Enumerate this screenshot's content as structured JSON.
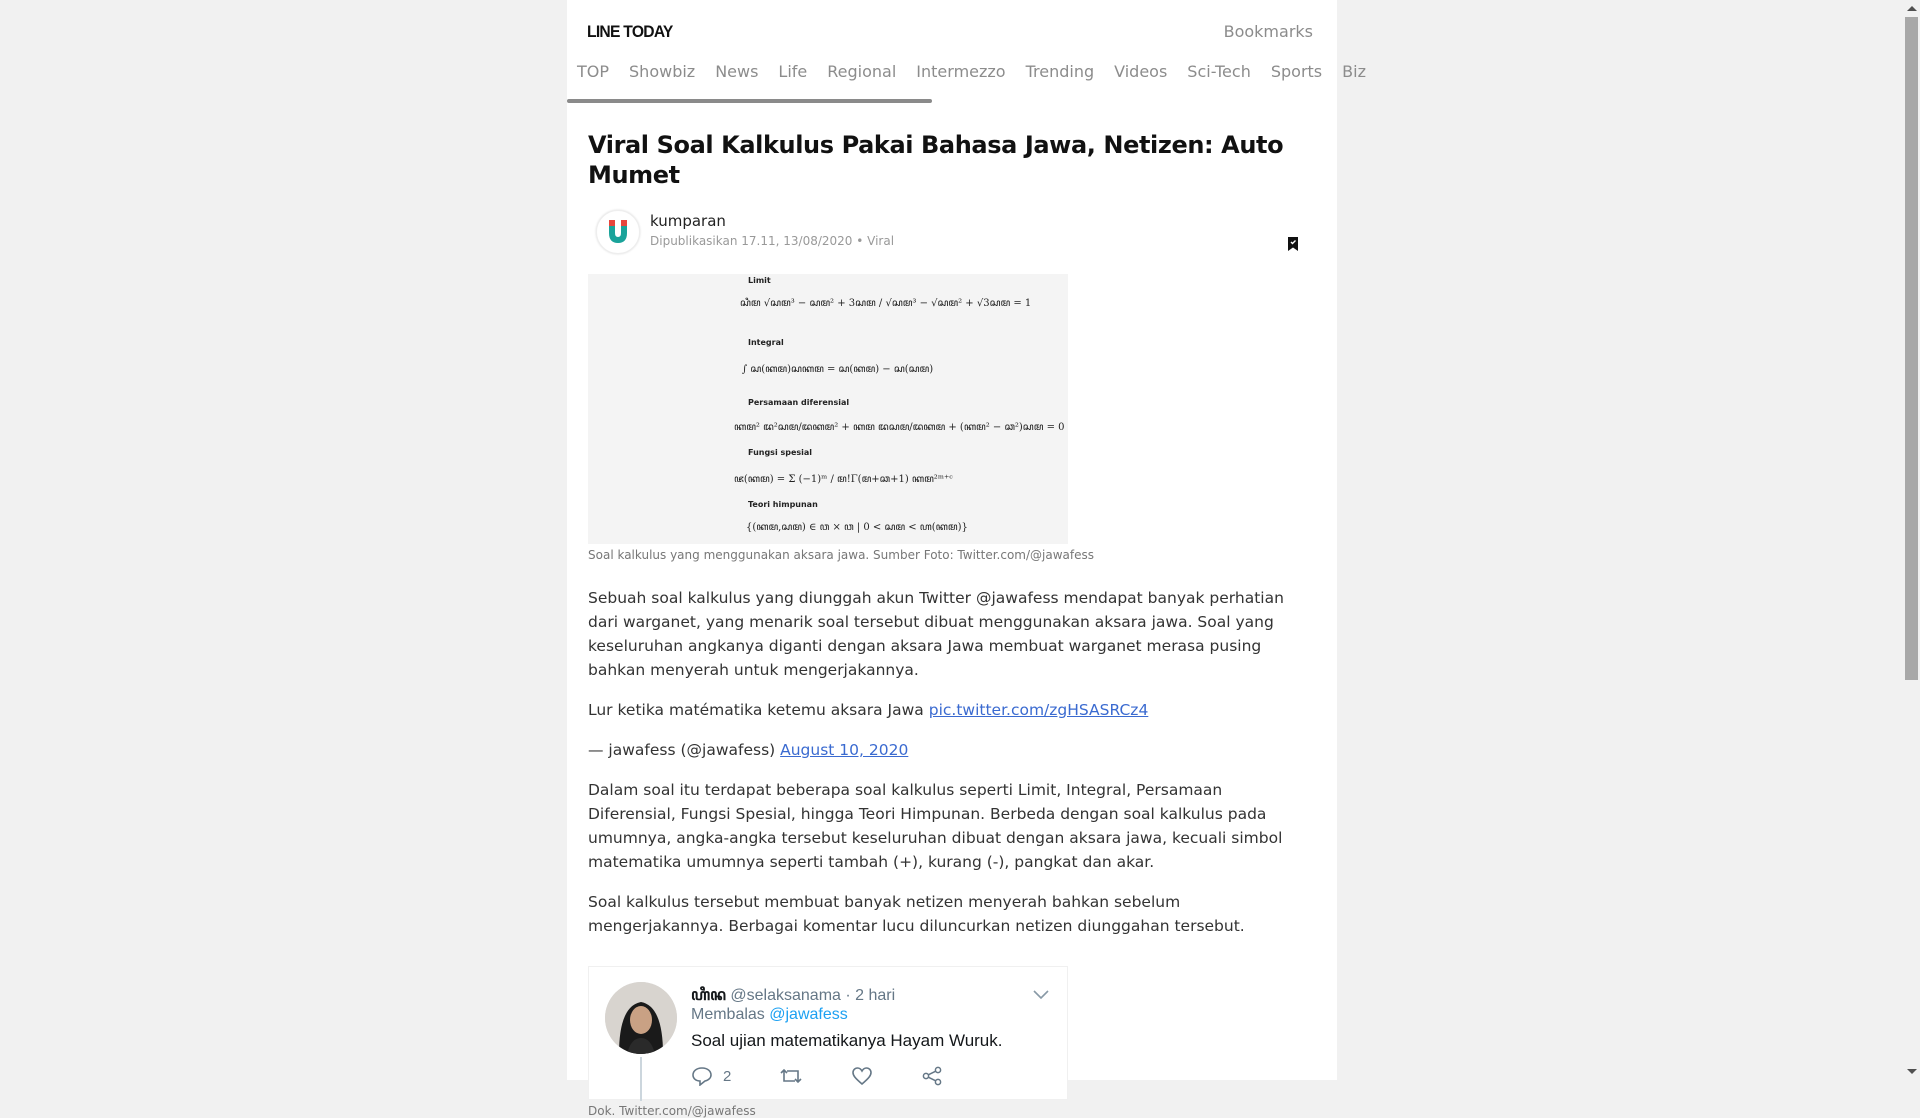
{
  "header": {
    "logo": "LINE TODAY",
    "bookmarks": "Bookmarks",
    "tabs": [
      "TOP",
      "Showbiz",
      "News",
      "Life",
      "Regional",
      "Intermezzo",
      "Trending",
      "Videos",
      "Sci-Tech",
      "Sports",
      "Biz"
    ]
  },
  "article": {
    "title": "Viral Soal Kalkulus Pakai Bahasa Jawa, Netizen: Auto Mumet",
    "publisher": "kumparan",
    "meta": "Dipublikasikan 17.11, 13/08/2020 • Viral",
    "image_caption": "Soal kalkulus yang menggunakan aksara jawa. Sumber Foto: Twitter.com/@jawafess",
    "image_labels": {
      "limit": "Limit",
      "integral": "Integral",
      "pd": "Persamaan diferensial",
      "fungsi": "Fungsi spesial",
      "himpunan": "Teori himpunan"
    },
    "para1": "Sebuah soal kalkulus yang diunggah akun Twitter @jawafess mendapat banyak perhatian dari warganet, yang menarik soal tersebut dibuat menggunakan aksara jawa. Soal yang keseluruhan angkanya diganti dengan aksara Jawa membuat warganet merasa pusing bahkan menyerah untuk mengerjakannya.",
    "quote_text": "Lur ketika matématika ketemu aksara Jawa ",
    "quote_link": "pic.twitter.com/zgHSASRCz4",
    "attribution_text": "— jawafess (@jawafess) ",
    "attribution_link": "August 10, 2020",
    "para2": "Dalam soal itu terdapat beberapa soal kalkulus seperti Limit, Integral, Persamaan Diferensial, Fungsi Spesial, hingga Teori Himpunan. Berbeda dengan soal kalkulus pada umumnya, angka-angka tersebut keseluruhan dibuat dengan aksara jawa, kecuali simbol matematika umumnya seperti tambah (+), kurang (-), pangkat dan akar.",
    "para3": "Soal kalkulus tersebut membuat banyak netizen menyerah bahkan sebelum mengerjakannya. Berbagai komentar lucu diluncurkan netizen diunggahan tersebut.",
    "tweet": {
      "name": "ꦲꦶꦤ",
      "handle": "@selaksanama · 2 hari",
      "reply_prefix": "Membalas ",
      "reply_mention": "@jawafess",
      "text": "Soal ujian matematikanya Hayam Wuruk.",
      "reply_count": "2"
    },
    "tweet_caption": "Dok. Twitter.com/@jawafess"
  },
  "colors": {
    "link": "#3a6ad0",
    "accent": "#111111"
  }
}
